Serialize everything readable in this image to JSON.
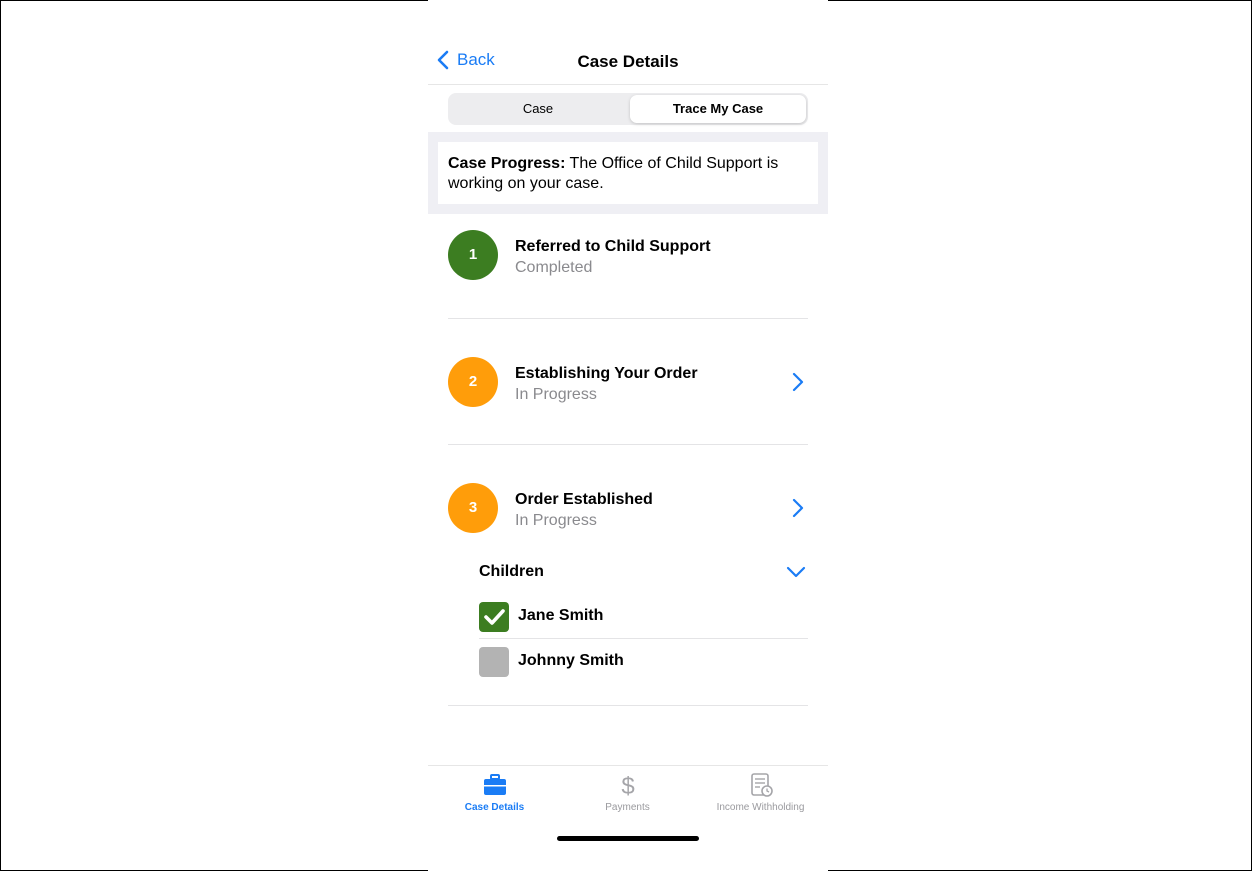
{
  "nav": {
    "back_label": "Back",
    "title": "Case Details"
  },
  "segmented": {
    "tabs": [
      {
        "label": "Case",
        "active": false
      },
      {
        "label": "Trace My Case",
        "active": true
      }
    ]
  },
  "banner": {
    "label": "Case Progress:",
    "text": "The Office of Child Support is working on your case."
  },
  "steps": [
    {
      "number": "1",
      "title": "Referred to Child Support",
      "status": "Completed",
      "color": "#3c7d21"
    },
    {
      "number": "2",
      "title": "Establishing Your Order",
      "status": "In Progress",
      "color": "#ff9d0a"
    },
    {
      "number": "3",
      "title": "Order Established",
      "status": "In Progress",
      "color": "#ff9d0a"
    }
  ],
  "children": {
    "header": "Children",
    "items": [
      {
        "name": "Jane Smith",
        "checked": true
      },
      {
        "name": "Johnny Smith",
        "checked": false
      }
    ]
  },
  "tabbar": {
    "items": [
      {
        "label": "Case Details",
        "icon": "briefcase-icon",
        "active": true
      },
      {
        "label": "Payments",
        "icon": "dollar-icon",
        "active": false
      },
      {
        "label": "Income Withholding",
        "icon": "document-clock-icon",
        "active": false
      }
    ]
  },
  "colors": {
    "accent": "#1a7cf5",
    "completed": "#3c7d21",
    "in_progress": "#ff9d0a",
    "unchecked": "#b3b3b3"
  }
}
